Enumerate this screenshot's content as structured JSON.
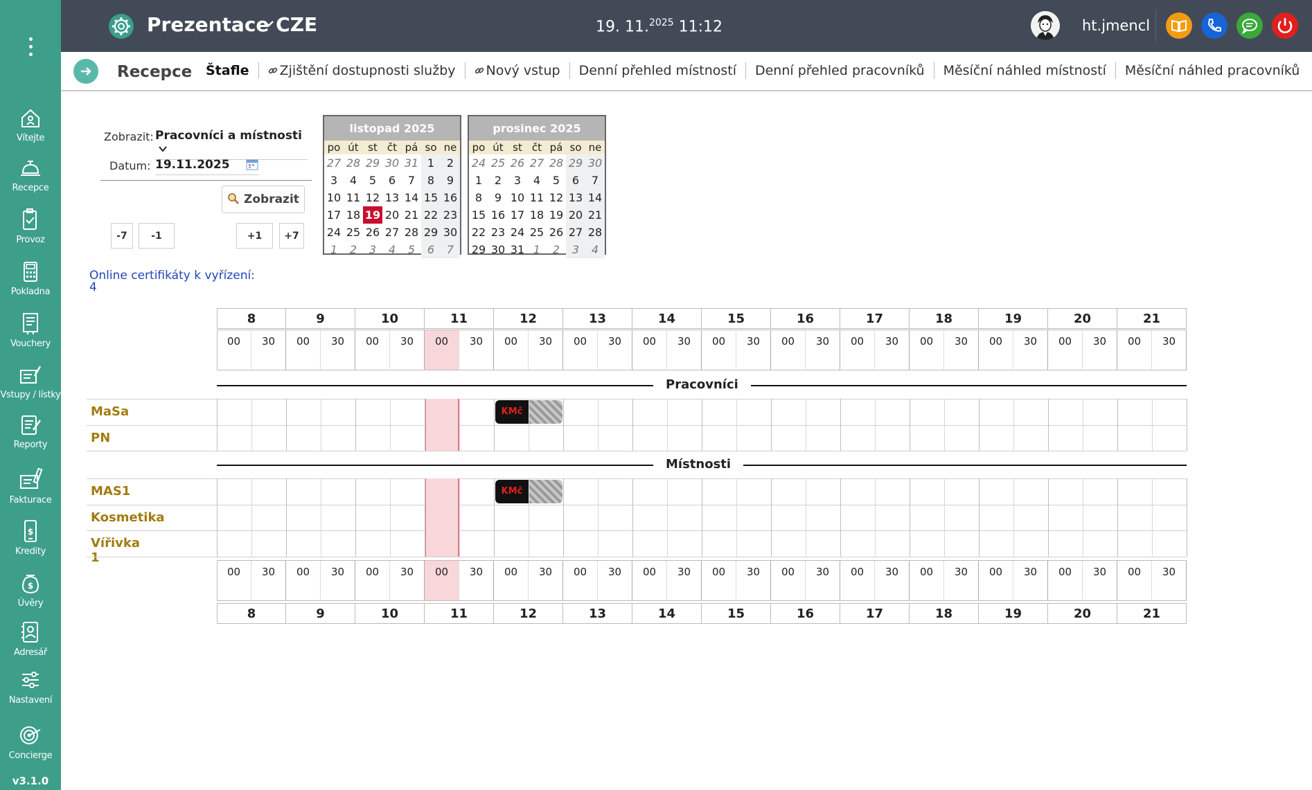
{
  "sidebar": {
    "items": [
      {
        "label": "Vítejte",
        "icon": "home-icon"
      },
      {
        "label": "Recepce",
        "icon": "reception-bell-icon"
      },
      {
        "label": "Provoz",
        "icon": "clipboard-icon"
      },
      {
        "label": "Pokladna",
        "icon": "cash-register-icon"
      },
      {
        "label": "Vouchery",
        "icon": "voucher-icon"
      },
      {
        "label": "Vstupy / lístky",
        "icon": "ticket-icon"
      },
      {
        "label": "Reporty",
        "icon": "report-icon"
      },
      {
        "label": "Fakturace",
        "icon": "invoice-icon"
      },
      {
        "label": "Kredity",
        "icon": "credit-icon"
      },
      {
        "label": "Úvěry",
        "icon": "loan-icon"
      },
      {
        "label": "Adresář",
        "icon": "address-book-icon"
      },
      {
        "label": "Nastavení",
        "icon": "settings-sliders-icon"
      },
      {
        "label": "Concierge",
        "icon": "concierge-icon"
      }
    ],
    "version": "v3.1.0"
  },
  "topbar": {
    "title": "Prezentace CZE",
    "date": "19. 11.",
    "year": "2025",
    "time": "11:12",
    "username": "ht.jmencl",
    "buttons": [
      {
        "icon": "book-icon",
        "color": "#f39c12"
      },
      {
        "icon": "phone-icon",
        "color": "#1565d8"
      },
      {
        "icon": "chat-icon",
        "color": "#3aa83a"
      },
      {
        "icon": "power-icon",
        "color": "#e0201e"
      }
    ]
  },
  "tabbar": {
    "section": "Recepce",
    "tabs": [
      {
        "label": "Štafle",
        "active": true,
        "link": false
      },
      {
        "label": "Zjištění dostupnosti služby",
        "active": false,
        "link": true
      },
      {
        "label": "Nový vstup",
        "active": false,
        "link": true
      },
      {
        "label": "Denní přehled místností",
        "active": false,
        "link": false
      },
      {
        "label": "Denní přehled pracovníků",
        "active": false,
        "link": false
      },
      {
        "label": "Měsíční náhled místností",
        "active": false,
        "link": false
      },
      {
        "label": "Měsíční náhled pracovníků",
        "active": false,
        "link": false
      }
    ]
  },
  "filter": {
    "show_label": "Zobrazit:",
    "show_value": "Pracovníci a místnosti",
    "date_label": "Datum:",
    "date_value": "19.11.2025",
    "submit_label": "Zobrazit",
    "steps": [
      "-7",
      "-1",
      "+1",
      "+7"
    ]
  },
  "calendars": [
    {
      "title": "listopad 2025",
      "dow": [
        "po",
        "út",
        "st",
        "čt",
        "pá",
        "so",
        "ne"
      ],
      "weeks": [
        [
          "27",
          "28",
          "29",
          "30",
          "31",
          "1",
          "2"
        ],
        [
          "3",
          "4",
          "5",
          "6",
          "7",
          "8",
          "9"
        ],
        [
          "10",
          "11",
          "12",
          "13",
          "14",
          "15",
          "16"
        ],
        [
          "17",
          "18",
          "19",
          "20",
          "21",
          "22",
          "23"
        ],
        [
          "24",
          "25",
          "26",
          "27",
          "28",
          "29",
          "30"
        ],
        [
          "1",
          "2",
          "3",
          "4",
          "5",
          "6",
          "7"
        ]
      ],
      "leading_other": 5,
      "trailing_other": 7,
      "today": "19"
    },
    {
      "title": "prosinec 2025",
      "dow": [
        "po",
        "út",
        "st",
        "čt",
        "pá",
        "so",
        "ne"
      ],
      "weeks": [
        [
          "24",
          "25",
          "26",
          "27",
          "28",
          "29",
          "30"
        ],
        [
          "1",
          "2",
          "3",
          "4",
          "5",
          "6",
          "7"
        ],
        [
          "8",
          "9",
          "10",
          "11",
          "12",
          "13",
          "14"
        ],
        [
          "15",
          "16",
          "17",
          "18",
          "19",
          "20",
          "21"
        ],
        [
          "22",
          "23",
          "24",
          "25",
          "26",
          "27",
          "28"
        ],
        [
          "29",
          "30",
          "31",
          "1",
          "2",
          "3",
          "4"
        ]
      ],
      "leading_other": 7,
      "trailing_other": 4,
      "today": null
    }
  ],
  "online": {
    "label": "Online certifikáty k vyřízení:",
    "count": "4"
  },
  "scheduler": {
    "hours": [
      "8",
      "9",
      "10",
      "11",
      "12",
      "13",
      "14",
      "15",
      "16",
      "17",
      "18",
      "19",
      "20",
      "21"
    ],
    "halves": [
      "00",
      "30"
    ],
    "current_slot_index": 6,
    "sections": [
      {
        "title": "Pracovníci",
        "rows": [
          {
            "name": "MaSa",
            "bookings": [
              {
                "slot": 8,
                "label": "KMč",
                "hatch_slot": 9
              }
            ]
          },
          {
            "name": "PN",
            "bookings": []
          }
        ]
      },
      {
        "title": "Místnosti",
        "rows": [
          {
            "name": "MAS1",
            "bookings": [
              {
                "slot": 8,
                "label": "KMč",
                "hatch_slot": 9
              }
            ]
          },
          {
            "name": "Kosmetika",
            "bookings": []
          },
          {
            "name": "Vířivka 1",
            "bookings": []
          }
        ]
      }
    ]
  }
}
